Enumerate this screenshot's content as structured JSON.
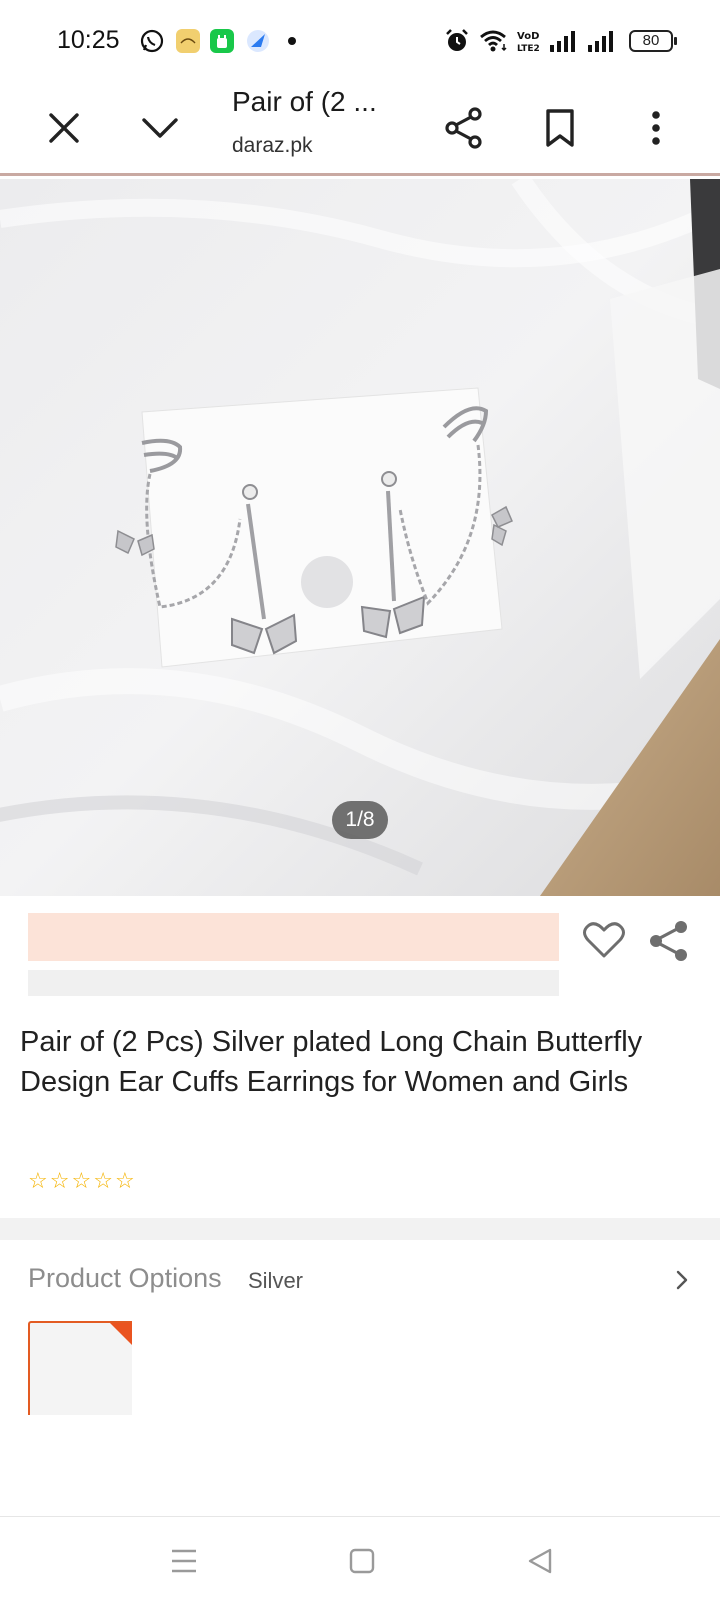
{
  "status_bar": {
    "time": "10:25",
    "battery": "80",
    "icons": [
      "whatsapp-icon",
      "app-icon",
      "app-icon-green",
      "browser-icon",
      "alarm-icon",
      "wifi-icon",
      "volte-icon",
      "signal-icon",
      "signal-icon"
    ]
  },
  "toolbar": {
    "title": "Pair of (2 ...",
    "url": "daraz.pk",
    "icons": [
      "close-icon",
      "chevron-down-icon",
      "share-icon",
      "bookmark-icon",
      "more-vert-icon"
    ]
  },
  "gallery": {
    "counter": "1/8"
  },
  "product": {
    "title": "Pair of (2 Pcs) Silver plated Long Chain Butterfly Design Ear Cuffs Earrings for Women and Girls",
    "rating": 0,
    "rating_max": 5,
    "accent": "#ea5420",
    "star_color": "#f5b301"
  },
  "options": {
    "label": "Product Options",
    "value": "Silver"
  }
}
